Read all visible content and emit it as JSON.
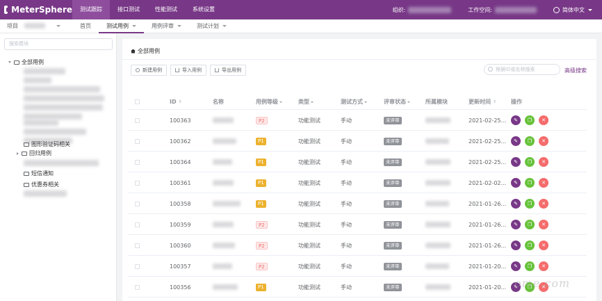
{
  "brand": {
    "name": "MeterSphere"
  },
  "topnav": [
    {
      "label": "测试跟踪",
      "active": true
    },
    {
      "label": "接口测试",
      "active": false
    },
    {
      "label": "性能测试",
      "active": false
    },
    {
      "label": "系统设置",
      "active": false
    }
  ],
  "header_right": {
    "org_label": "组织:",
    "workspace_label": "工作空间:",
    "language": "简体中文"
  },
  "subnav": {
    "project_label": "项目",
    "items": [
      {
        "label": "首页",
        "active": false,
        "caret": false
      },
      {
        "label": "测试用例",
        "active": true,
        "caret": true
      },
      {
        "label": "用例评审",
        "active": false,
        "caret": true
      },
      {
        "label": "测试计划",
        "active": false,
        "caret": true
      }
    ]
  },
  "sidebar": {
    "search_placeholder": "搜索模块",
    "root": "全部用例",
    "nodes": [
      {
        "label": "图形验证码相关",
        "expandable": false
      },
      {
        "label": "回归用例",
        "expandable": true
      },
      {
        "label": "短信通知",
        "expandable": false
      },
      {
        "label": "优惠券相关",
        "expandable": false
      }
    ]
  },
  "main": {
    "breadcrumb": "全部用例",
    "buttons": {
      "create": "新建用例",
      "import": "导入用例",
      "export": "导出用例"
    },
    "search_placeholder": "根据ID或名称搜索",
    "advanced_search": "高级搜索",
    "columns": {
      "id": "ID",
      "name": "名称",
      "priority": "用例等级",
      "type": "类型",
      "method": "测试方式",
      "review": "评审状态",
      "module": "所属模块",
      "updated": "更新时间",
      "ops": "操作"
    },
    "rows": [
      {
        "id": "100363",
        "priority": "P2",
        "type": "功能测试",
        "method": "手动",
        "review": "未评审",
        "updated": "2021-02-25..."
      },
      {
        "id": "100362",
        "priority": "P1",
        "type": "功能测试",
        "method": "手动",
        "review": "未评审",
        "updated": "2021-02-25..."
      },
      {
        "id": "100364",
        "priority": "P1",
        "type": "功能测试",
        "method": "手动",
        "review": "未评审",
        "updated": "2021-02-25..."
      },
      {
        "id": "100361",
        "priority": "P1",
        "type": "功能测试",
        "method": "手动",
        "review": "未评审",
        "updated": "2021-02-02..."
      },
      {
        "id": "100358",
        "priority": "P1",
        "type": "功能测试",
        "method": "手动",
        "review": "未评审",
        "updated": "2021-01-26..."
      },
      {
        "id": "100359",
        "priority": "P2",
        "type": "功能测试",
        "method": "手动",
        "review": "未评审",
        "updated": "2021-01-26..."
      },
      {
        "id": "100360",
        "priority": "P2",
        "type": "功能测试",
        "method": "手动",
        "review": "未评审",
        "updated": "2021-01-26..."
      },
      {
        "id": "100357",
        "priority": "P2",
        "type": "功能测试",
        "method": "手动",
        "review": "未评审",
        "updated": "2021-01-20..."
      },
      {
        "id": "100356",
        "priority": "P1",
        "type": "功能测试",
        "method": "手动",
        "review": "未评审",
        "updated": "2021-01-20..."
      }
    ]
  },
  "colors": {
    "brand": "#783887",
    "p1": "#ecb22e",
    "p2": "#f56c6c",
    "copy": "#67c23a",
    "delete": "#f56c6c"
  }
}
